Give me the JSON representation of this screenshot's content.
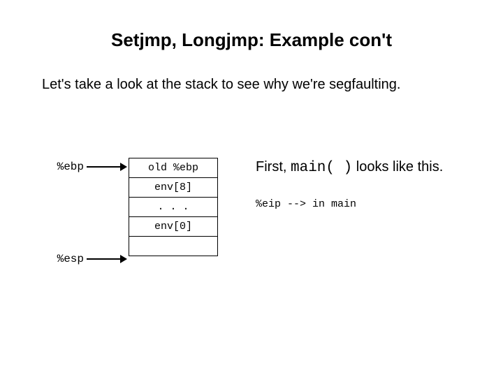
{
  "title": "Setjmp, Longjmp: Example con't",
  "subtitle": "Let's take a look at the stack to see why we're segfaulting.",
  "pointers": {
    "ebp": "%ebp",
    "esp": "%esp"
  },
  "stack": {
    "cells": [
      "old %ebp",
      "env[8]",
      ". . .",
      "env[0]",
      ""
    ]
  },
  "notes": {
    "first_prefix": "First, ",
    "first_code": "main( )",
    "first_suffix": " looks like this.",
    "eip": "%eip --> in main"
  }
}
